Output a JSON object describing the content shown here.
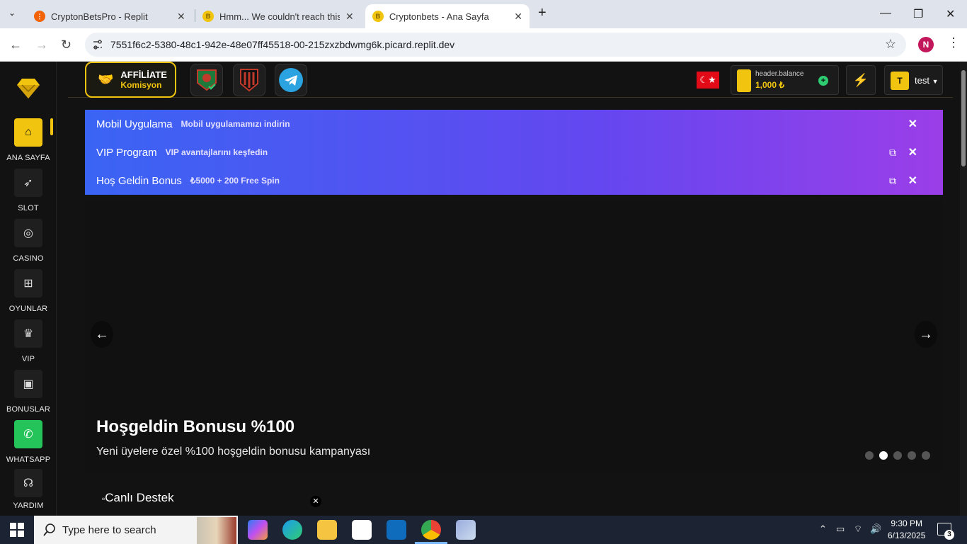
{
  "browser": {
    "tabs": [
      {
        "title": "CryptonBetsPro - Replit"
      },
      {
        "title": "Hmm... We couldn't reach this a"
      },
      {
        "title": "Cryptonbets - Ana Sayfa"
      }
    ],
    "url": "7551f6c2-5380-48c1-942e-48e07ff45518-00-215zxzbdwmg6k.picard.replit.dev",
    "profile_initial": "N"
  },
  "sidebar": {
    "items": [
      {
        "label": "ANA SAYFA",
        "icon": "home-icon"
      },
      {
        "label": "SLOT",
        "icon": "rocket-icon"
      },
      {
        "label": "CASINO",
        "icon": "coins-icon"
      },
      {
        "label": "OYUNLAR",
        "icon": "gamepad-icon"
      },
      {
        "label": "VIP",
        "icon": "crown-icon"
      },
      {
        "label": "BONUSLAR",
        "icon": "gift-icon"
      },
      {
        "label": "WHATSAPP",
        "icon": "whatsapp-icon"
      },
      {
        "label": "YARDIM",
        "icon": "headset-icon"
      }
    ]
  },
  "header": {
    "affiliate_title": "AFFİLİATE",
    "affiliate_sub": "Komisyon",
    "balance_label": "header.balance",
    "balance_amount": "1,000 ₺",
    "user_initial": "T",
    "user_name": "test"
  },
  "promos": [
    {
      "title": "Mobil Uygulama",
      "subtitle": "Mobil uygulamamızı indirin"
    },
    {
      "title": "VIP Program",
      "subtitle": "VIP avantajlarını keşfedin"
    },
    {
      "title": "Hoş Geldin Bonus",
      "subtitle": "₺5000 + 200 Free Spin"
    }
  ],
  "hero": {
    "title": "Hoşgeldin Bonusu %100",
    "subtitle": "Yeni üyelere özel %100 hoşgeldin bonusu kampanyası",
    "prev": "←",
    "next": "→",
    "slide_count": 5,
    "active_slide": 2
  },
  "support": {
    "alt_text": "Canlı Destek"
  },
  "taskbar": {
    "search_placeholder": "Type here to search",
    "time": "9:30 PM",
    "date": "6/13/2025",
    "notifications": "3"
  }
}
